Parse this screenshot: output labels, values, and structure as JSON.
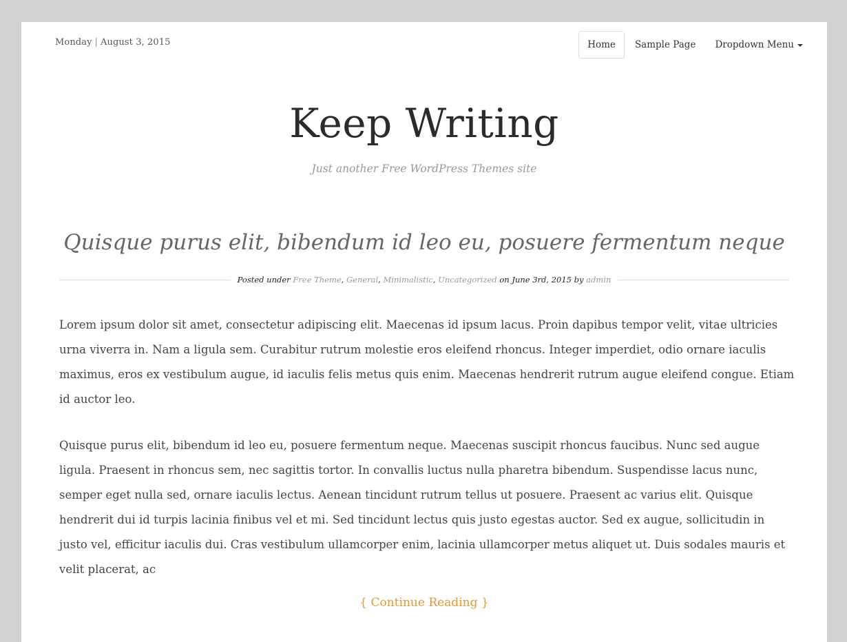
{
  "header": {
    "day": "Monday",
    "separator": "|",
    "date": "August 3, 2015"
  },
  "nav": {
    "items": [
      {
        "label": "Home",
        "active": true
      },
      {
        "label": "Sample Page",
        "active": false
      },
      {
        "label": "Dropdown Menu",
        "active": false,
        "has_dropdown": true,
        "icon": "caret-down-icon"
      }
    ]
  },
  "site": {
    "title": "Keep Writing",
    "tagline": "Just another Free WordPress Themes site"
  },
  "post": {
    "title": "Quisque purus elit, bibendum id leo eu, posuere fermentum neque",
    "meta": {
      "posted_under": "Posted under",
      "categories": [
        "Free Theme",
        "General",
        "Minimalistic",
        "Uncategorized"
      ],
      "category_separator": ",",
      "on_label": "on",
      "date": "June 3rd, 2015",
      "by_label": "by",
      "author": "admin"
    },
    "paragraphs": [
      "Lorem ipsum dolor sit amet, consectetur adipiscing elit. Maecenas id ipsum lacus. Proin dapibus tempor velit, vitae ultricies urna viverra in. Nam a ligula sem. Curabitur rutrum molestie eros eleifend rhoncus. Integer imperdiet, odio ornare iaculis maximus, eros ex vestibulum augue, id iaculis felis metus quis enim. Maecenas hendrerit rutrum augue eleifend congue. Etiam id auctor leo.",
      "Quisque purus elit, bibendum id leo eu, posuere fermentum neque. Maecenas suscipit rhoncus faucibus. Nunc sed augue ligula. Praesent in rhoncus sem, nec sagittis tortor. In convallis luctus nulla pharetra bibendum. Suspendisse lacus nunc, semper eget nulla sed, ornare iaculis lectus. Aenean tincidunt rutrum tellus ut posuere. Praesent ac varius elit. Quisque hendrerit dui id turpis lacinia finibus vel et mi. Sed tincidunt lectus quis justo egestas auctor. Sed ex augue, sollicitudin in justo vel, efficitur iaculis dui. Cras vestibulum ullamcorper enim, lacinia ullamcorper metus aliquet ut. Duis sodales mauris et velit placerat, ac"
    ],
    "continue_label": "{ Continue Reading }"
  },
  "colors": {
    "background": "#d3d3d3",
    "accent": "#e8962e",
    "meta_link": "#999999"
  }
}
